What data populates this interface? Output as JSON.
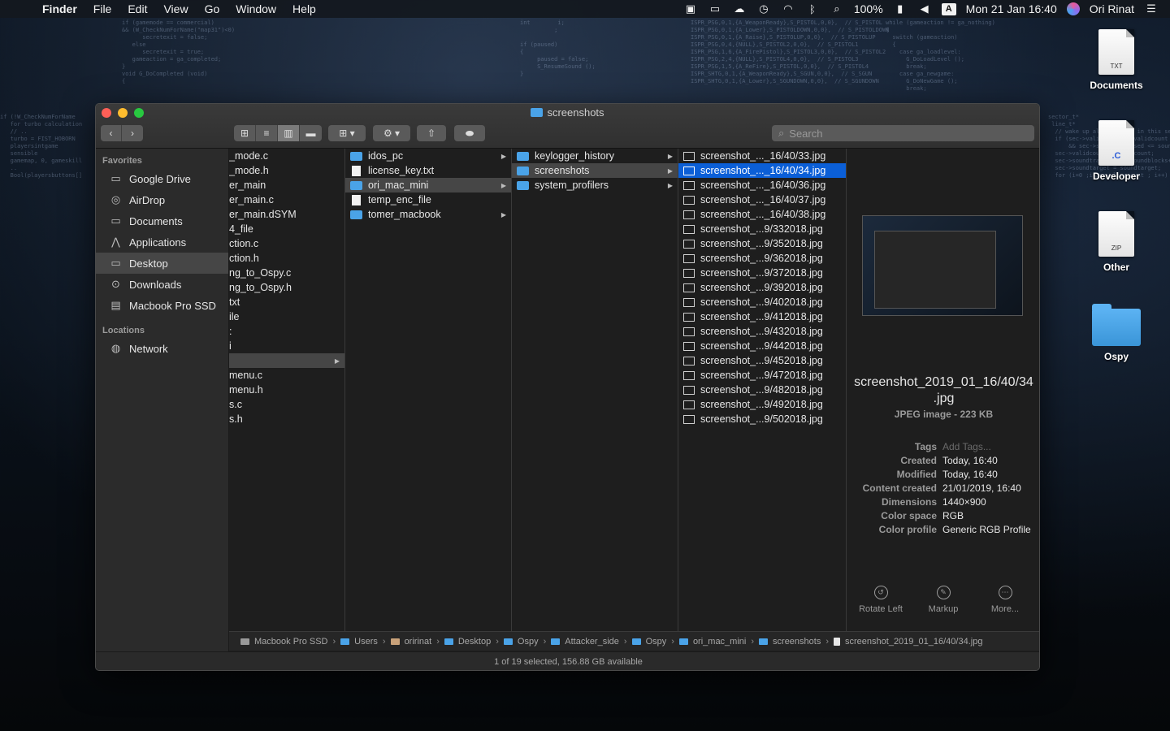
{
  "menubar": {
    "app": "Finder",
    "menus": [
      "File",
      "Edit",
      "View",
      "Go",
      "Window",
      "Help"
    ],
    "battery": "100%",
    "input_source": "A",
    "datetime": "Mon 21 Jan  16:40",
    "user": "Ori Rinat"
  },
  "desktop": {
    "icons": [
      {
        "label": "Documents",
        "badge": "TXT"
      },
      {
        "label": "Developer",
        "badge": ".C"
      },
      {
        "label": "Other",
        "badge": "ZIP"
      },
      {
        "label": "Ospy",
        "badge": ""
      }
    ]
  },
  "window": {
    "title": "screenshots",
    "search_placeholder": "Search",
    "sidebar": {
      "favorites_header": "Favorites",
      "favorites": [
        "Google Drive",
        "AirDrop",
        "Documents",
        "Applications",
        "Desktop",
        "Downloads",
        "Macbook Pro SSD"
      ],
      "locations_header": "Locations",
      "locations": [
        "Network"
      ]
    },
    "col1": [
      "_mode.c",
      "_mode.h",
      "er_main",
      "er_main.c",
      "er_main.dSYM",
      "4_file",
      "ction.c",
      "ction.h",
      "ng_to_Ospy.c",
      "ng_to_Ospy.h",
      "txt",
      "ile",
      ":",
      "i",
      "",
      "menu.c",
      "menu.h",
      "s.c",
      "s.h"
    ],
    "col2": [
      "idos_pc",
      "license_key.txt",
      "ori_mac_mini",
      "temp_enc_file",
      "tomer_macbook"
    ],
    "col3": [
      "keylogger_history",
      "screenshots",
      "system_profilers"
    ],
    "col4": [
      "screenshot_..._16/40/33.jpg",
      "screenshot_..._16/40/34.jpg",
      "screenshot_..._16/40/36.jpg",
      "screenshot_..._16/40/37.jpg",
      "screenshot_..._16/40/38.jpg",
      "screenshot_...9/332018.jpg",
      "screenshot_...9/352018.jpg",
      "screenshot_...9/362018.jpg",
      "screenshot_...9/372018.jpg",
      "screenshot_...9/392018.jpg",
      "screenshot_...9/402018.jpg",
      "screenshot_...9/412018.jpg",
      "screenshot_...9/432018.jpg",
      "screenshot_...9/442018.jpg",
      "screenshot_...9/452018.jpg",
      "screenshot_...9/472018.jpg",
      "screenshot_...9/482018.jpg",
      "screenshot_...9/492018.jpg",
      "screenshot_...9/502018.jpg"
    ],
    "preview": {
      "name_line1": "screenshot_2019_01_16/40/34",
      "name_line2": ".jpg",
      "kind": "JPEG image - 223 KB",
      "meta": [
        {
          "k": "Tags",
          "v": "Add Tags..."
        },
        {
          "k": "Created",
          "v": "Today, 16:40"
        },
        {
          "k": "Modified",
          "v": "Today, 16:40"
        },
        {
          "k": "Content created",
          "v": "21/01/2019, 16:40"
        },
        {
          "k": "Dimensions",
          "v": "1440×900"
        },
        {
          "k": "Color space",
          "v": "RGB"
        },
        {
          "k": "Color profile",
          "v": "Generic RGB Profile"
        }
      ],
      "actions": [
        "Rotate Left",
        "Markup",
        "More..."
      ]
    },
    "path": [
      "Macbook Pro SSD",
      "Users",
      "oririnat",
      "Desktop",
      "Ospy",
      "Attacker_side",
      "Ospy",
      "ori_mac_mini",
      "screenshots",
      "screenshot_2019_01_16/40/34.jpg"
    ],
    "status": "1 of 19 selected, 156.88 GB available"
  }
}
